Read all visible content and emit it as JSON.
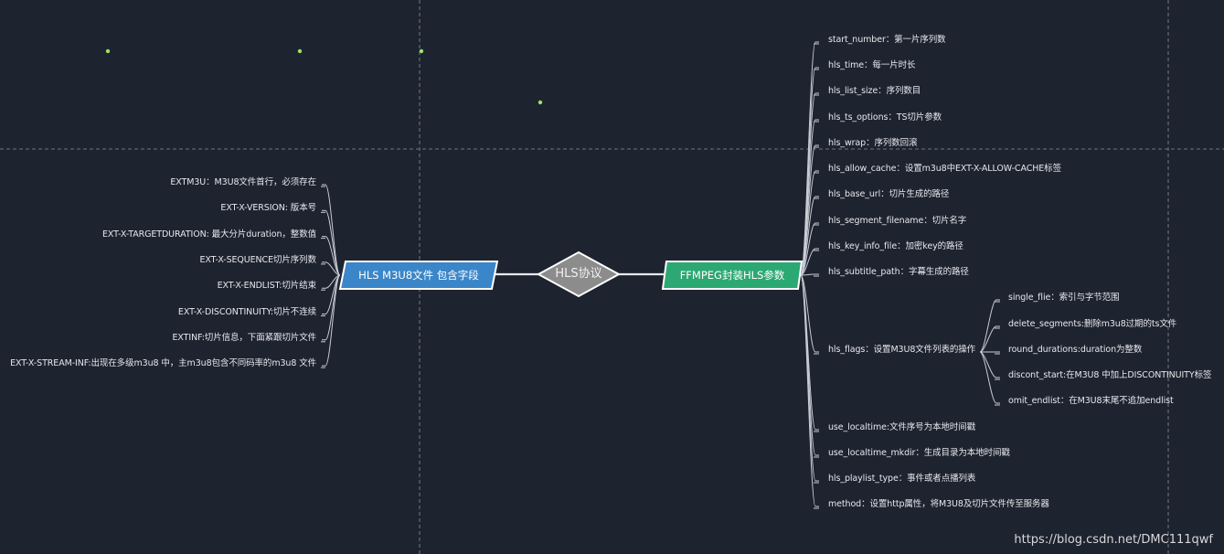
{
  "root": {
    "label": "HLS协议",
    "color": "#8c8c8c"
  },
  "left_branch": {
    "label": "HLS M3U8文件 包含字段",
    "color": "#3a86c8",
    "items": [
      "EXTM3U：M3U8文件首行，必须存在",
      "EXT-X-VERSION: 版本号",
      "EXT-X-TARGETDURATION: 最大分片duration，整数值",
      "EXT-X-SEQUENCE切片序列数",
      "EXT-X-ENDLIST:切片结束",
      "EXT-X-DISCONTINUITY:切片不连续",
      "EXTINF:切片信息，下面紧跟切片文件",
      "EXT-X-STREAM-INF:出现在多级m3u8 中，主m3u8包含不同码率的m3u8 文件"
    ]
  },
  "right_branch": {
    "label": "FFMPEG封装HLS参数",
    "color": "#2ca872",
    "items": [
      "start_number：第一片序列数",
      "hls_time：每一片时长",
      "hls_list_size：序列数目",
      "hls_ts_options：TS切片参数",
      "hls_wrap：序列数回滚",
      "hls_allow_cache：设置m3u8中EXT-X-ALLOW-CACHE标签",
      "hls_base_url：切片生成的路径",
      "hls_segment_filename：切片名字",
      "hls_key_info_file：加密key的路径",
      "hls_subtitle_path：字幕生成的路径",
      "hls_flags：设置M3U8文件列表的操作",
      "use_localtime:文件序号为本地时间戳",
      "use_localtime_mkdir：生成目录为本地时间戳",
      "hls_playlist_type：事件或者点播列表",
      "method：设置http属性，将M3U8及切片文件传至服务器"
    ],
    "flags": [
      "single_flie：索引与字节范围",
      "delete_segments:删除m3u8过期的ts文件",
      "round_durations:duration为整数",
      "discont_start:在M3U8 中加上DISCONTINUITY标签",
      "omit_endlist：在M3U8末尾不追加endlist"
    ]
  },
  "watermark": "https://blog.csdn.net/DMC111qwf",
  "colors": {
    "background": "#1e2330",
    "connector": "#c8ccd4",
    "guide": "#8a8f9a",
    "dot": "#9be36a"
  }
}
